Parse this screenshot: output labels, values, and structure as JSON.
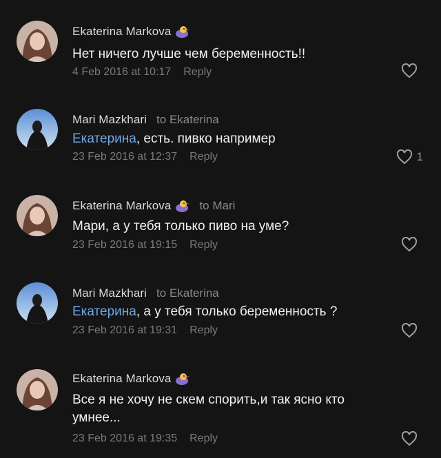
{
  "comments": [
    {
      "author": "Ekaterina Markova",
      "reply_to": "",
      "mention": "",
      "text": "Нет ничего  лучше  чем беременность!!",
      "date": "4 Feb 2016 at 10:17",
      "reply_label": "Reply",
      "likes": ""
    },
    {
      "author": "Mari Mazkhari",
      "reply_to": "to Ekaterina",
      "mention": "Екатерина",
      "text": ", есть. пивко например",
      "date": "23 Feb 2016 at 12:37",
      "reply_label": "Reply",
      "likes": "1"
    },
    {
      "author": "Ekaterina Markova",
      "reply_to": "to Mari",
      "mention": "",
      "text": "Мари, а у тебя только пиво на уме?",
      "date": "23 Feb 2016 at 19:15",
      "reply_label": "Reply",
      "likes": ""
    },
    {
      "author": "Mari Mazkhari",
      "reply_to": "to Ekaterina",
      "mention": "Екатерина",
      "text": ", а у тебя только беременность ?",
      "date": "23 Feb 2016 at 19:31",
      "reply_label": "Reply",
      "likes": ""
    },
    {
      "author": "Ekaterina Markova",
      "reply_to": "",
      "mention": "",
      "text": "Все я не хочу  не скем спорить,и так ясно кто умнее...",
      "date": "23 Feb 2016 at 19:35",
      "reply_label": "Reply",
      "likes": ""
    }
  ],
  "icons": {
    "like": "heart-outline-icon",
    "badge": "duck-sticker-icon"
  },
  "colors": {
    "background": "#141414",
    "mention": "#6ea8e6",
    "meta": "#7a7a7a"
  }
}
